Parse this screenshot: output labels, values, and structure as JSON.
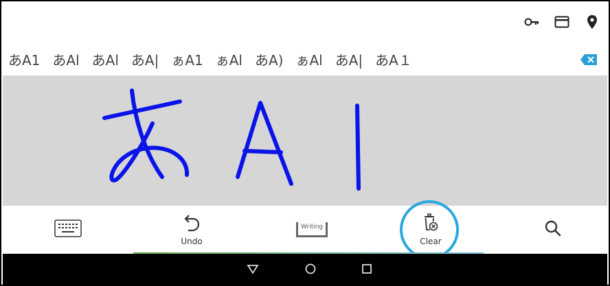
{
  "candidates": [
    "あA1",
    "あAl",
    "あAl",
    "あA|",
    "ぁA1",
    "ぁAl",
    "あA)",
    "ぁAl",
    "あA|",
    "あA１"
  ],
  "toolbar": {
    "undo_label": "Undo",
    "writing_label": "Writing",
    "clear_label": "Clear"
  },
  "colors": {
    "ink": "#0a14e8",
    "canvas_bg": "#d6d6d6",
    "accent": "#29a8df"
  },
  "icons": {
    "top": [
      "key-icon",
      "card-icon",
      "location-pin-icon"
    ],
    "delete": "backspace-icon",
    "keyboard": "keyboard-icon",
    "undo": "undo-icon",
    "clear": "trash-clear-icon",
    "search": "search-icon",
    "nav": [
      "back-icon",
      "home-icon",
      "recents-icon"
    ]
  }
}
